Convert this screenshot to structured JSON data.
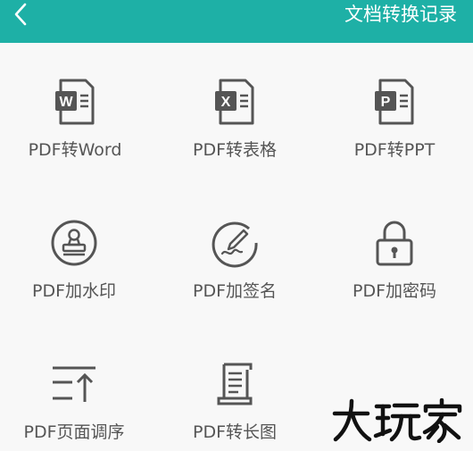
{
  "header": {
    "back_icon": "chevron-left-icon",
    "history_label": "文档转换记录",
    "bar_color": "#1eb0a6"
  },
  "tools": [
    {
      "label": "PDF转Word",
      "icon": "word-doc-icon"
    },
    {
      "label": "PDF转表格",
      "icon": "excel-doc-icon"
    },
    {
      "label": "PDF转PPT",
      "icon": "ppt-doc-icon"
    },
    {
      "label": "PDF加水印",
      "icon": "stamp-icon"
    },
    {
      "label": "PDF加签名",
      "icon": "signature-pen-icon"
    },
    {
      "label": "PDF加密码",
      "icon": "padlock-icon"
    },
    {
      "label": "PDF页面调序",
      "icon": "reorder-pages-icon"
    },
    {
      "label": "PDF转长图",
      "icon": "scroll-document-icon"
    }
  ],
  "watermark": {
    "text": "大玩家"
  }
}
